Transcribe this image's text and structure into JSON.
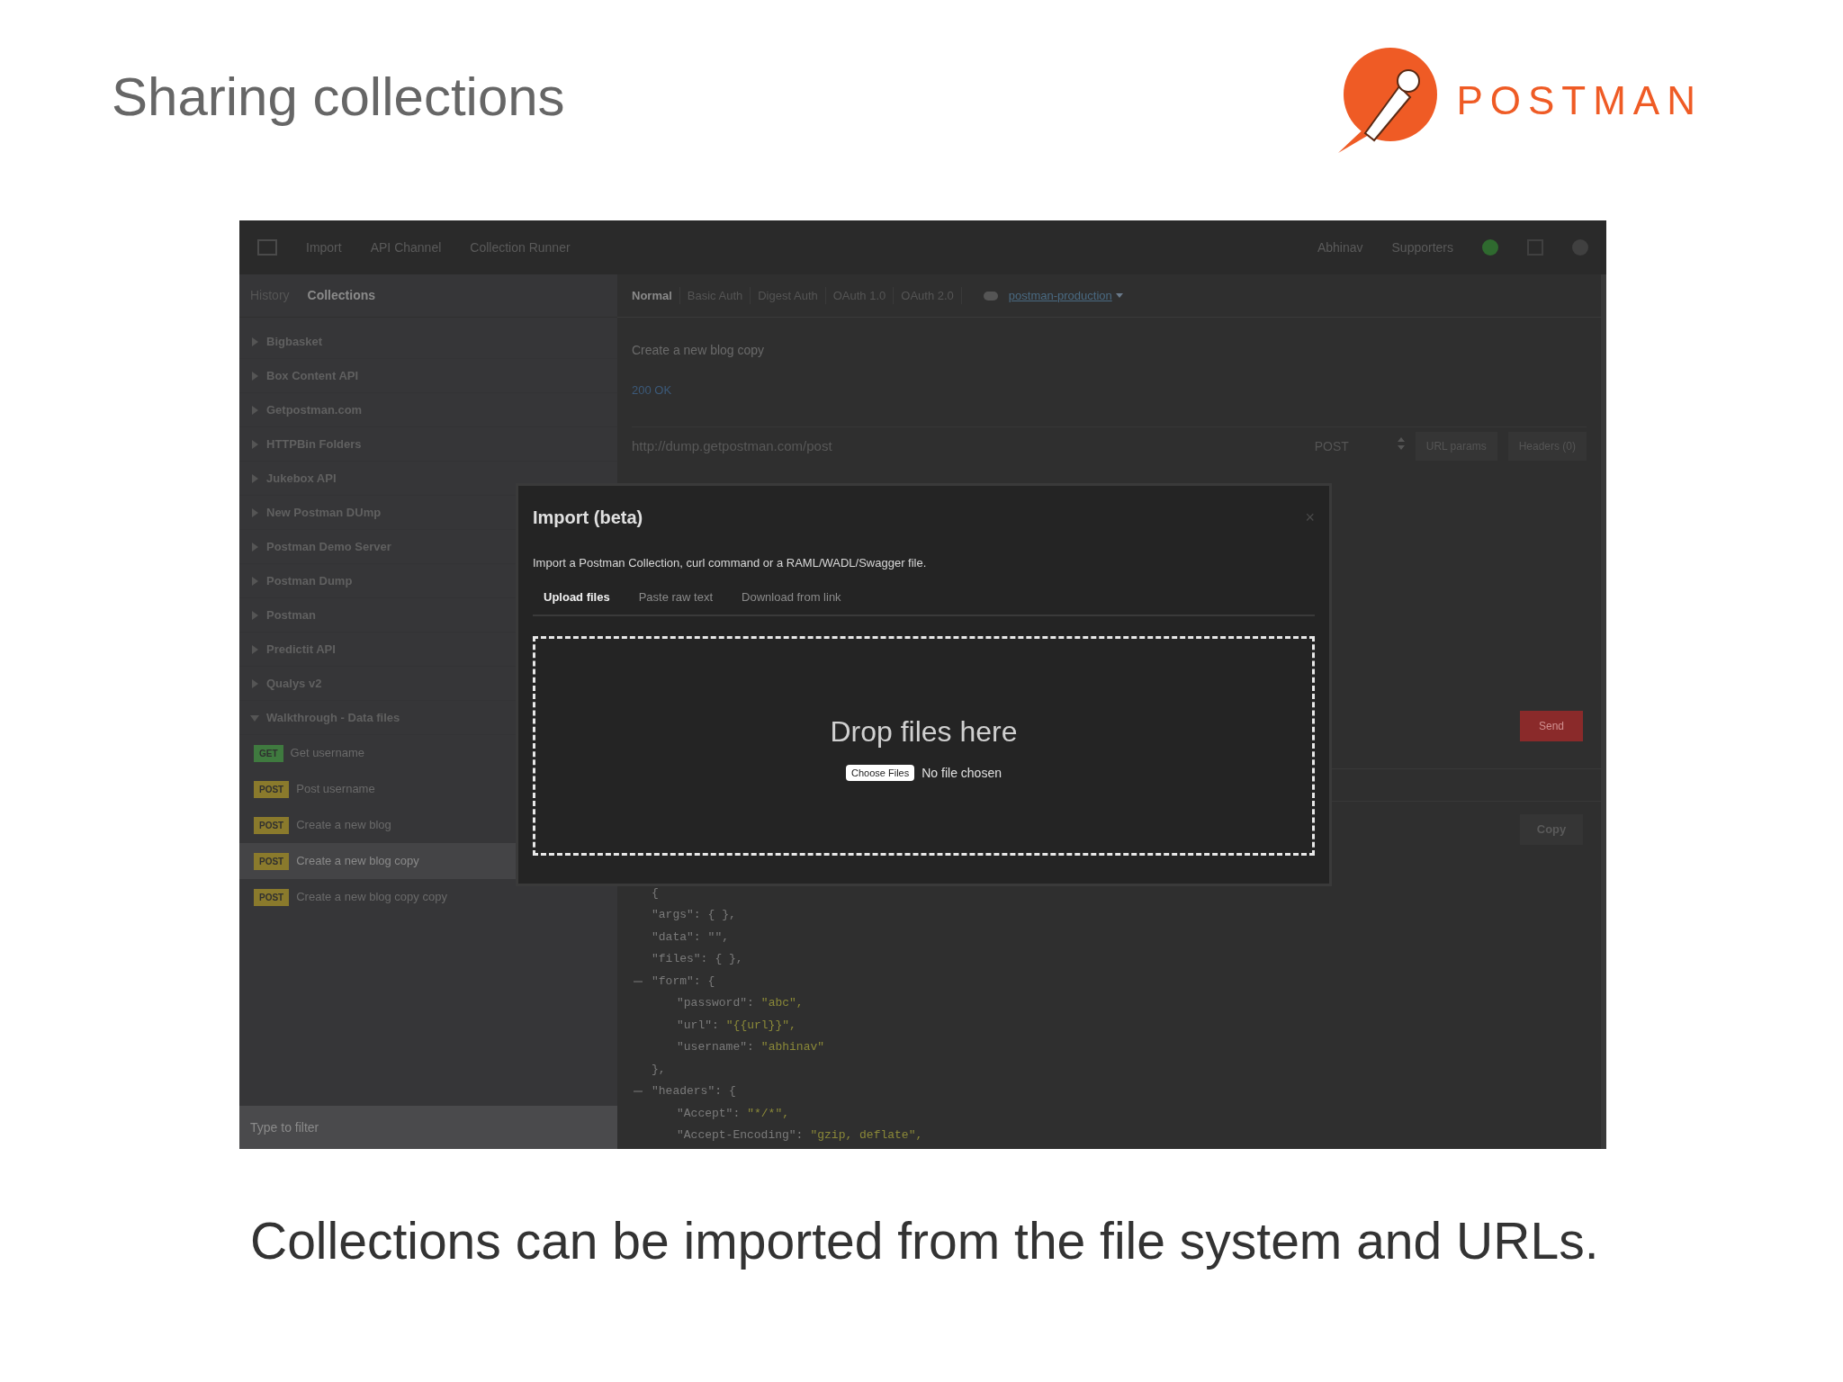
{
  "slide": {
    "title": "Sharing collections",
    "logo_text": "POSTMAN",
    "caption": "Collections can be imported from the file system and URLs."
  },
  "top_bar": {
    "items": [
      "Import",
      "API Channel",
      "Collection Runner"
    ],
    "right_items": [
      "Abhinav",
      "Supporters"
    ]
  },
  "sidebar": {
    "tabs": [
      {
        "label": "History",
        "selected": false
      },
      {
        "label": "Collections",
        "selected": true
      }
    ],
    "collections": [
      {
        "name": "Bigbasket",
        "expanded": false
      },
      {
        "name": "Box Content API",
        "expanded": false
      },
      {
        "name": "Getpostman.com",
        "expanded": false
      },
      {
        "name": "HTTPBin Folders",
        "expanded": false
      },
      {
        "name": "Jukebox API",
        "expanded": false
      },
      {
        "name": "New Postman DUmp",
        "expanded": false
      },
      {
        "name": "Postman Demo Server",
        "expanded": false
      },
      {
        "name": "Postman Dump",
        "expanded": false
      },
      {
        "name": "Postman",
        "expanded": false
      },
      {
        "name": "Predictit API",
        "expanded": false
      },
      {
        "name": "Qualys v2",
        "expanded": false
      },
      {
        "name": "Walkthrough - Data files",
        "expanded": true,
        "children": [
          {
            "method": "GET",
            "color": "#3f7a3f",
            "name": "Get username",
            "selected": false
          },
          {
            "method": "POST",
            "color": "#8a7a2c",
            "name": "Post username",
            "selected": false
          },
          {
            "method": "POST",
            "color": "#8a7a2c",
            "name": "Create a new blog",
            "selected": false
          },
          {
            "method": "POST",
            "color": "#8a7a2c",
            "name": "Create a new blog copy",
            "selected": true
          },
          {
            "method": "POST",
            "color": "#8a7a2c",
            "name": "Create a new blog copy copy",
            "selected": false
          }
        ]
      }
    ],
    "filter": {
      "placeholder": "Type to filter"
    }
  },
  "main": {
    "auth_tabs": [
      {
        "label": "Normal",
        "selected": true
      },
      {
        "label": "Basic Auth",
        "selected": false
      },
      {
        "label": "Digest Auth",
        "selected": false
      },
      {
        "label": "OAuth 1.0",
        "selected": false
      },
      {
        "label": "OAuth 2.0",
        "selected": false
      }
    ],
    "environment": "postman-production",
    "request_name": "Create a new blog copy",
    "status": "200 OK",
    "url": "http://dump.getpostman.com/post",
    "method": "POST",
    "buttons": [
      "URL params",
      "Headers (0)"
    ],
    "send": "Send",
    "copy": "Copy",
    "code": [
      {
        "key": "{"
      },
      {
        "key": "\"args\":",
        "value": "{ },",
        "kind": "plain"
      },
      {
        "key": "\"data\":",
        "value": "\"\",",
        "kind": "plain"
      },
      {
        "key": "\"files\":",
        "value": "{ },",
        "kind": "plain"
      },
      {
        "key": "\"form\":",
        "value": "{",
        "kind": "plain",
        "expanded": true,
        "children": [
          {
            "key": "\"password\":",
            "value": "\"abc\",",
            "kind": "string"
          },
          {
            "key": "\"url\":",
            "value": "\"{{url}}\",",
            "kind": "string"
          },
          {
            "key": "\"username\":",
            "value": "\"abhinav\"",
            "kind": "string"
          }
        ]
      },
      {
        "key": "},"
      },
      {
        "key": "\"headers\":",
        "value": "{",
        "kind": "plain",
        "expanded": true,
        "children": [
          {
            "key": "\"Accept\":",
            "value": "\"*/*\",",
            "kind": "string"
          },
          {
            "key": "\"Accept-Encoding\":",
            "value": "\"gzip, deflate\",",
            "kind": "string"
          }
        ]
      }
    ]
  },
  "dialog": {
    "title": "Import (beta)",
    "close": "×",
    "description": "Import a Postman Collection, curl command or a RAML/WADL/Swagger file.",
    "tabs": [
      {
        "label": "Upload files",
        "selected": true
      },
      {
        "label": "Paste raw text",
        "selected": false
      },
      {
        "label": "Download from link",
        "selected": false
      }
    ],
    "drop_text": "Drop files here",
    "choose_button": "Choose Files",
    "file_status": "No file chosen"
  }
}
